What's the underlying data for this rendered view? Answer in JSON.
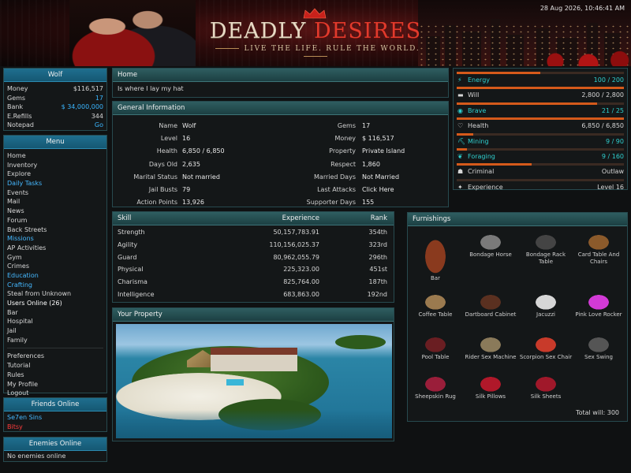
{
  "header": {
    "brand_word1": "DEADLY",
    "brand_word2": "DESIRES",
    "tagline": "LIVE THE LIFE. RULE THE WORLD.",
    "datetime": "28 Aug 2026, 10:46:41 AM"
  },
  "user_panel": {
    "name": "Wolf",
    "rows": [
      {
        "label": "Money",
        "value": "$116,517"
      },
      {
        "label": "Gems",
        "value": "17"
      },
      {
        "label": "Bank",
        "value": "$ 34,000,000"
      },
      {
        "label": "E.Refills",
        "value": "344"
      },
      {
        "label": "Notepad",
        "value": "Go"
      }
    ]
  },
  "menu": {
    "title": "Menu",
    "items": [
      "Home",
      "Inventory",
      "Explore",
      "Daily Tasks",
      "Events",
      "Mail",
      "News",
      "Forum",
      "Back Streets",
      "Missions",
      "AP Activities",
      "Gym",
      "Crimes",
      "Education",
      "Crafting",
      "Steal from Unknown",
      "Users Online (26)",
      "Bar",
      "Hospital",
      "Jail",
      "Family"
    ],
    "items2": [
      "Preferences",
      "Tutorial",
      "Rules",
      "My Profile",
      "Logout"
    ]
  },
  "friends": {
    "title": "Friends Online",
    "items": [
      "Se7en Sins",
      "Bitsy"
    ]
  },
  "enemies": {
    "title": "Enemies Online",
    "empty": "No enemies online"
  },
  "home": {
    "title": "Home",
    "text": "Is where I lay my hat"
  },
  "general": {
    "title": "General Information",
    "left": [
      {
        "label": "Name",
        "value": "Wolf"
      },
      {
        "label": "Level",
        "value": "16"
      },
      {
        "label": "Health",
        "value": "6,850 / 6,850"
      },
      {
        "label": "Days Old",
        "value": "2,635"
      },
      {
        "label": "Marital Status",
        "value": "Not married"
      },
      {
        "label": "Jail Busts",
        "value": "79"
      },
      {
        "label": "Action Points",
        "value": "13,926"
      }
    ],
    "right": [
      {
        "label": "Gems",
        "value": "17"
      },
      {
        "label": "Money",
        "value": "$ 116,517"
      },
      {
        "label": "Property",
        "value": "Private Island"
      },
      {
        "label": "Respect",
        "value": "1,860"
      },
      {
        "label": "Married Days",
        "value": "Not Married"
      },
      {
        "label": "Last Attacks",
        "value": "Click Here"
      },
      {
        "label": "Supporter Days",
        "value": "155"
      }
    ]
  },
  "stats": [
    {
      "label": "Energy",
      "value": "100 / 200",
      "fill": 0.5,
      "icon": "bolt-icon",
      "glyph": "⚡"
    },
    {
      "label": "Will",
      "value": "2,800 / 2,800",
      "fill": 1.0,
      "icon": "dumbbell-icon",
      "glyph": "▬"
    },
    {
      "label": "Brave",
      "value": "21 / 25",
      "fill": 0.84,
      "icon": "shield-icon",
      "glyph": "◉"
    },
    {
      "label": "Health",
      "value": "6,850 / 6,850",
      "fill": 1.0,
      "icon": "heart-icon",
      "glyph": "♡"
    },
    {
      "label": "Mining",
      "value": "9 / 90",
      "fill": 0.1,
      "icon": "pickaxe-icon",
      "glyph": "⛏"
    },
    {
      "label": "Foraging",
      "value": "9 / 160",
      "fill": 0.06,
      "icon": "leaf-icon",
      "glyph": "❦"
    },
    {
      "label": "Criminal",
      "value": "Outlaw",
      "fill": 0.45,
      "icon": "mask-icon",
      "glyph": "☗"
    },
    {
      "label": "Experience",
      "value": "Level 16",
      "fill": 0.0,
      "icon": "star-icon",
      "glyph": "✦"
    }
  ],
  "skills": {
    "headers": [
      "Skill",
      "Experience",
      "Rank"
    ],
    "rows": [
      {
        "skill": "Strength",
        "exp": "50,157,783.91",
        "rank": "354th"
      },
      {
        "skill": "Agility",
        "exp": "110,156,025.37",
        "rank": "323rd"
      },
      {
        "skill": "Guard",
        "exp": "80,962,055.79",
        "rank": "296th"
      },
      {
        "skill": "Physical",
        "exp": "225,323.00",
        "rank": "451st"
      },
      {
        "skill": "Charisma",
        "exp": "825,764.00",
        "rank": "187th"
      },
      {
        "skill": "Intelligence",
        "exp": "683,863.00",
        "rank": "192nd"
      }
    ]
  },
  "property": {
    "title": "Your Property"
  },
  "furnishings": {
    "title": "Furnishings",
    "items": [
      "Bar",
      "Bondage Horse",
      "Bondage Rack Table",
      "Card Table And Chairs",
      "Coffee Table",
      "Dartboard Cabinet",
      "Jacuzzi",
      "Pink Love Rocker",
      "Pool Table",
      "Rider Sex Machine",
      "Scorpion Sex Chair",
      "Sex Swing",
      "Sheepskin Rug",
      "Silk Pillows",
      "Silk Sheets"
    ],
    "total": "Total will: 300"
  },
  "colors": {
    "accent": "#2f5e61",
    "link": "#3ab6ff",
    "bar": "#d55a1b",
    "teal_text": "#2fd0cf"
  }
}
